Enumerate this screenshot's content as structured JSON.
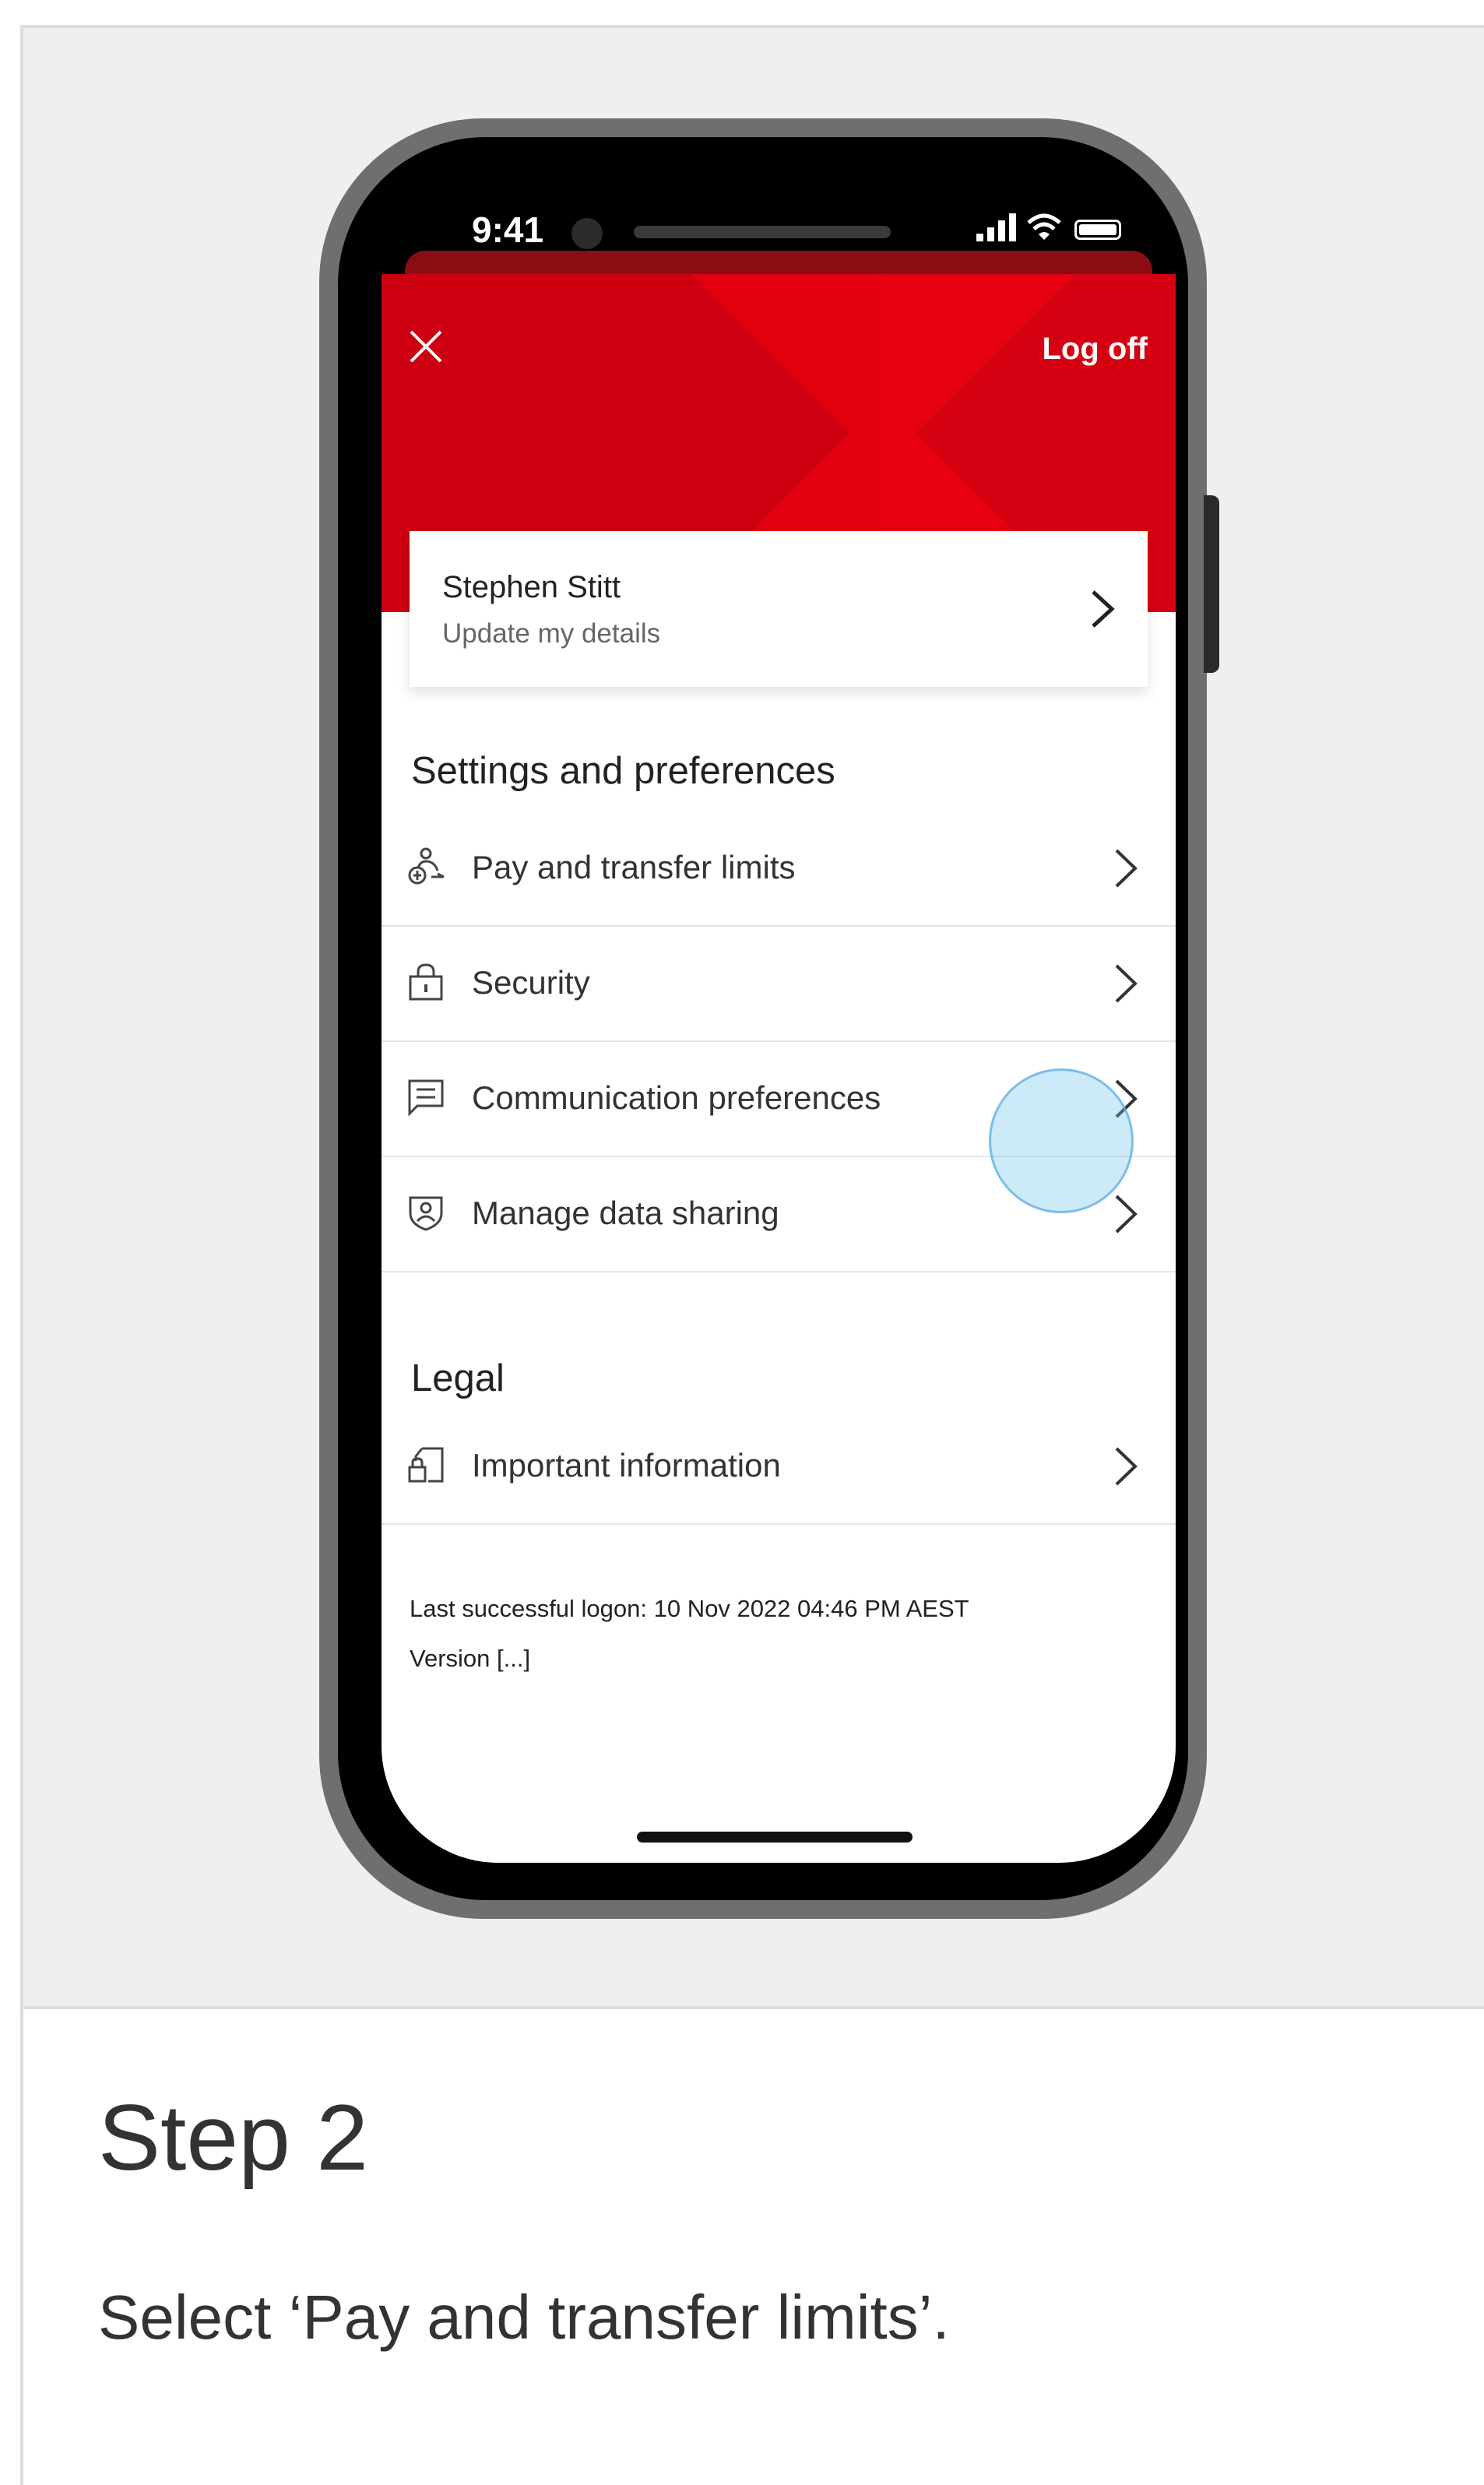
{
  "status_bar": {
    "time": "9:41"
  },
  "header": {
    "logoff_label": "Log off"
  },
  "profile": {
    "name": "Stephen Stitt",
    "subtitle": "Update my details"
  },
  "settings": {
    "title": "Settings and preferences",
    "items": [
      {
        "label": "Pay and transfer limits",
        "icon": "person-money-icon"
      },
      {
        "label": "Security",
        "icon": "lock-icon"
      },
      {
        "label": "Communication preferences",
        "icon": "message-icon"
      },
      {
        "label": "Manage data sharing",
        "icon": "shield-user-icon"
      }
    ]
  },
  "legal": {
    "title": "Legal",
    "items": [
      {
        "label": "Important information",
        "icon": "document-lock-icon"
      }
    ]
  },
  "footer": {
    "last_logon": "Last successful logon: 10 Nov 2022 04:46 PM AEST",
    "version": "Version [...]"
  },
  "step": {
    "title": "Step 2",
    "description": "Select ‘Pay and transfer limits’."
  },
  "colors": {
    "brand_red": "#db0011",
    "tap_highlight": "#6ec3eb"
  }
}
